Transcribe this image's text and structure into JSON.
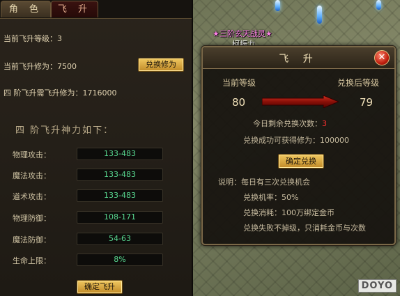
{
  "tabs": {
    "character": "角 色",
    "ascension": "飞 升"
  },
  "panel": {
    "current_level_label": "当前飞升等级：3",
    "current_cultivation_label": "当前飞升修为：7500",
    "exchange_button": "兑换修为",
    "requirement_label": "四 阶飞升需飞升修为：1716000",
    "section_title": "四 阶飞升神力如下：",
    "stats": [
      {
        "label": "物理攻击：",
        "value": "133-483"
      },
      {
        "label": "魔法攻击：",
        "value": "133-483"
      },
      {
        "label": "道术攻击：",
        "value": "133-483"
      },
      {
        "label": "物理防御：",
        "value": "108-171"
      },
      {
        "label": "魔法防御：",
        "value": "54-63"
      },
      {
        "label": "生命上限：",
        "value": "8%"
      }
    ],
    "confirm_ascend_button": "确定飞升"
  },
  "scene": {
    "character_title": "★三阶玄天战灵★",
    "character_name": "柯振力",
    "watermark": "DOYO"
  },
  "dialog": {
    "title": "飞 升",
    "current_level_label": "当前等级",
    "after_level_label": "兑换后等级",
    "current_level": "80",
    "after_level": "79",
    "remaining_label": "今日剩余兑换次数：",
    "remaining_count": "3",
    "gain_label": "兑换成功可获得修为：100000",
    "confirm_button": "确定兑换",
    "notes": [
      "说明：每日有三次兑换机会",
      "兑换机率：50%",
      "兑换消耗：100万绑定金币",
      "兑换失败不掉级，只消耗金币与次数"
    ]
  }
}
